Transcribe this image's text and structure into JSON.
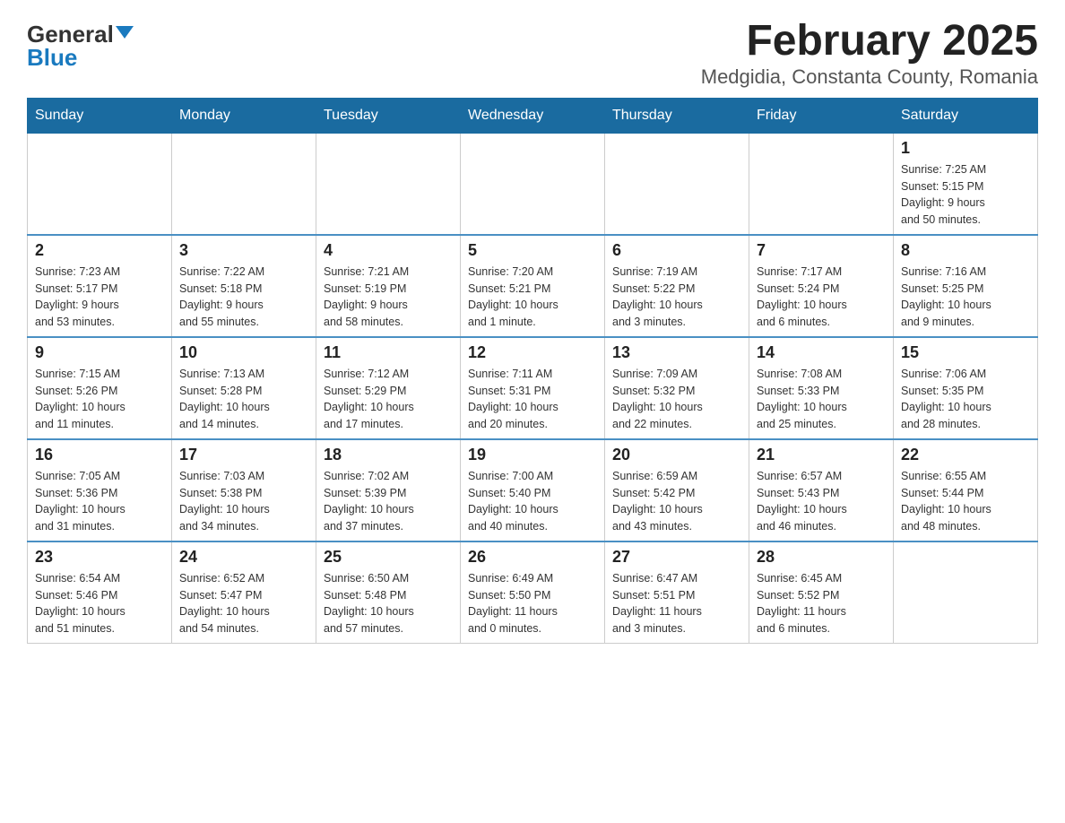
{
  "header": {
    "logo_general": "General",
    "logo_blue": "Blue",
    "title": "February 2025",
    "subtitle": "Medgidia, Constanta County, Romania"
  },
  "days_of_week": [
    "Sunday",
    "Monday",
    "Tuesday",
    "Wednesday",
    "Thursday",
    "Friday",
    "Saturday"
  ],
  "weeks": [
    [
      {
        "day": "",
        "info": ""
      },
      {
        "day": "",
        "info": ""
      },
      {
        "day": "",
        "info": ""
      },
      {
        "day": "",
        "info": ""
      },
      {
        "day": "",
        "info": ""
      },
      {
        "day": "",
        "info": ""
      },
      {
        "day": "1",
        "info": "Sunrise: 7:25 AM\nSunset: 5:15 PM\nDaylight: 9 hours\nand 50 minutes."
      }
    ],
    [
      {
        "day": "2",
        "info": "Sunrise: 7:23 AM\nSunset: 5:17 PM\nDaylight: 9 hours\nand 53 minutes."
      },
      {
        "day": "3",
        "info": "Sunrise: 7:22 AM\nSunset: 5:18 PM\nDaylight: 9 hours\nand 55 minutes."
      },
      {
        "day": "4",
        "info": "Sunrise: 7:21 AM\nSunset: 5:19 PM\nDaylight: 9 hours\nand 58 minutes."
      },
      {
        "day": "5",
        "info": "Sunrise: 7:20 AM\nSunset: 5:21 PM\nDaylight: 10 hours\nand 1 minute."
      },
      {
        "day": "6",
        "info": "Sunrise: 7:19 AM\nSunset: 5:22 PM\nDaylight: 10 hours\nand 3 minutes."
      },
      {
        "day": "7",
        "info": "Sunrise: 7:17 AM\nSunset: 5:24 PM\nDaylight: 10 hours\nand 6 minutes."
      },
      {
        "day": "8",
        "info": "Sunrise: 7:16 AM\nSunset: 5:25 PM\nDaylight: 10 hours\nand 9 minutes."
      }
    ],
    [
      {
        "day": "9",
        "info": "Sunrise: 7:15 AM\nSunset: 5:26 PM\nDaylight: 10 hours\nand 11 minutes."
      },
      {
        "day": "10",
        "info": "Sunrise: 7:13 AM\nSunset: 5:28 PM\nDaylight: 10 hours\nand 14 minutes."
      },
      {
        "day": "11",
        "info": "Sunrise: 7:12 AM\nSunset: 5:29 PM\nDaylight: 10 hours\nand 17 minutes."
      },
      {
        "day": "12",
        "info": "Sunrise: 7:11 AM\nSunset: 5:31 PM\nDaylight: 10 hours\nand 20 minutes."
      },
      {
        "day": "13",
        "info": "Sunrise: 7:09 AM\nSunset: 5:32 PM\nDaylight: 10 hours\nand 22 minutes."
      },
      {
        "day": "14",
        "info": "Sunrise: 7:08 AM\nSunset: 5:33 PM\nDaylight: 10 hours\nand 25 minutes."
      },
      {
        "day": "15",
        "info": "Sunrise: 7:06 AM\nSunset: 5:35 PM\nDaylight: 10 hours\nand 28 minutes."
      }
    ],
    [
      {
        "day": "16",
        "info": "Sunrise: 7:05 AM\nSunset: 5:36 PM\nDaylight: 10 hours\nand 31 minutes."
      },
      {
        "day": "17",
        "info": "Sunrise: 7:03 AM\nSunset: 5:38 PM\nDaylight: 10 hours\nand 34 minutes."
      },
      {
        "day": "18",
        "info": "Sunrise: 7:02 AM\nSunset: 5:39 PM\nDaylight: 10 hours\nand 37 minutes."
      },
      {
        "day": "19",
        "info": "Sunrise: 7:00 AM\nSunset: 5:40 PM\nDaylight: 10 hours\nand 40 minutes."
      },
      {
        "day": "20",
        "info": "Sunrise: 6:59 AM\nSunset: 5:42 PM\nDaylight: 10 hours\nand 43 minutes."
      },
      {
        "day": "21",
        "info": "Sunrise: 6:57 AM\nSunset: 5:43 PM\nDaylight: 10 hours\nand 46 minutes."
      },
      {
        "day": "22",
        "info": "Sunrise: 6:55 AM\nSunset: 5:44 PM\nDaylight: 10 hours\nand 48 minutes."
      }
    ],
    [
      {
        "day": "23",
        "info": "Sunrise: 6:54 AM\nSunset: 5:46 PM\nDaylight: 10 hours\nand 51 minutes."
      },
      {
        "day": "24",
        "info": "Sunrise: 6:52 AM\nSunset: 5:47 PM\nDaylight: 10 hours\nand 54 minutes."
      },
      {
        "day": "25",
        "info": "Sunrise: 6:50 AM\nSunset: 5:48 PM\nDaylight: 10 hours\nand 57 minutes."
      },
      {
        "day": "26",
        "info": "Sunrise: 6:49 AM\nSunset: 5:50 PM\nDaylight: 11 hours\nand 0 minutes."
      },
      {
        "day": "27",
        "info": "Sunrise: 6:47 AM\nSunset: 5:51 PM\nDaylight: 11 hours\nand 3 minutes."
      },
      {
        "day": "28",
        "info": "Sunrise: 6:45 AM\nSunset: 5:52 PM\nDaylight: 11 hours\nand 6 minutes."
      },
      {
        "day": "",
        "info": ""
      }
    ]
  ]
}
